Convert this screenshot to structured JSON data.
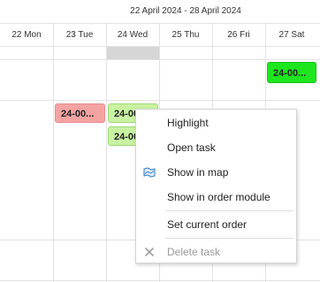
{
  "calendar": {
    "range_title": "22 April 2024 - 28 April 2024",
    "days": [
      "22 Mon",
      "23 Tue",
      "24 Wed",
      "25 Thu",
      "26 Fri",
      "27 Sat"
    ]
  },
  "tasks": [
    {
      "label": "24-00...",
      "color": "#1ee61e"
    },
    {
      "label": "24-00...",
      "color": "#f4a3a3"
    },
    {
      "label": "24-00...",
      "color": "#c9f2a2"
    },
    {
      "label": "24-00...",
      "color": "#c9f2a2"
    }
  ],
  "context_menu": {
    "items": [
      {
        "label": "Highlight",
        "icon": "",
        "enabled": true
      },
      {
        "label": "Open task",
        "icon": "",
        "enabled": true
      },
      {
        "label": "Show in map",
        "icon": "map-icon",
        "enabled": true
      },
      {
        "label": "Show in order module",
        "icon": "",
        "enabled": true
      },
      {
        "label": "Set current order",
        "icon": "",
        "enabled": true
      },
      {
        "label": "Delete task",
        "icon": "close-icon",
        "enabled": false
      }
    ]
  }
}
